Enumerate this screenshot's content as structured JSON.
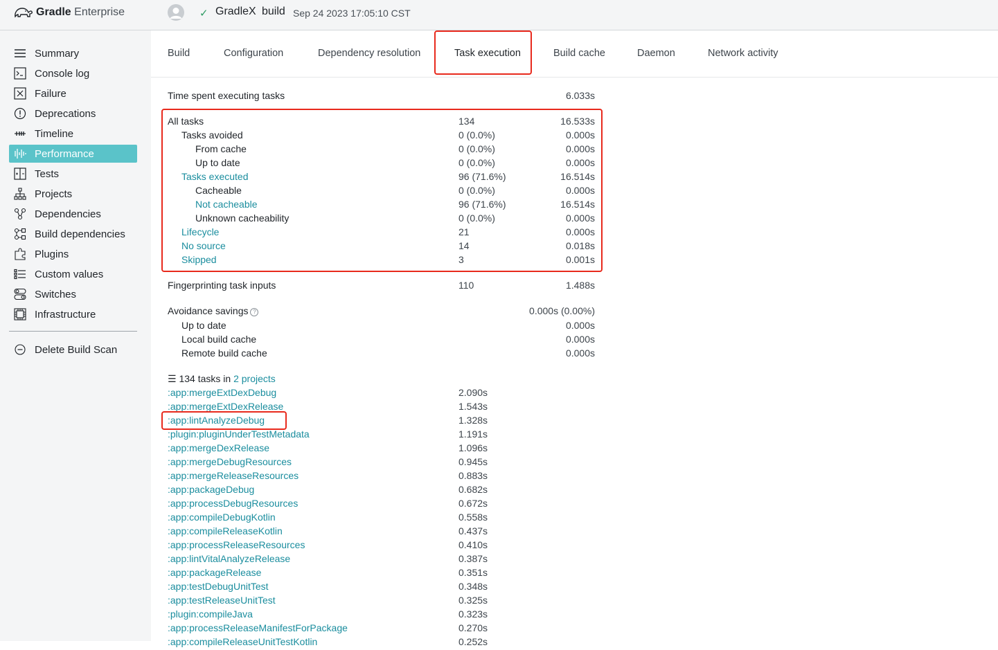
{
  "header": {
    "logo_bold": "Gradle",
    "logo_light": "Enterprise",
    "project": "GradleX",
    "task": "build",
    "date": "Sep 24 2023 17:05:10 CST"
  },
  "sidebar": {
    "items": [
      {
        "label": "Summary",
        "icon": "list-icon"
      },
      {
        "label": "Console log",
        "icon": "terminal-icon"
      },
      {
        "label": "Failure",
        "icon": "x-box-icon"
      },
      {
        "label": "Deprecations",
        "icon": "alert-circle-icon"
      },
      {
        "label": "Timeline",
        "icon": "timeline-icon"
      },
      {
        "label": "Performance",
        "icon": "waveform-icon"
      },
      {
        "label": "Tests",
        "icon": "tests-icon"
      },
      {
        "label": "Projects",
        "icon": "hierarchy-icon"
      },
      {
        "label": "Dependencies",
        "icon": "dependencies-icon"
      },
      {
        "label": "Build dependencies",
        "icon": "build-dependencies-icon"
      },
      {
        "label": "Plugins",
        "icon": "plugin-icon"
      },
      {
        "label": "Custom values",
        "icon": "custom-values-icon"
      },
      {
        "label": "Switches",
        "icon": "switches-icon"
      },
      {
        "label": "Infrastructure",
        "icon": "infrastructure-icon"
      }
    ],
    "active": "Performance",
    "delete_label": "Delete Build Scan"
  },
  "tabs": [
    "Build",
    "Configuration",
    "Dependency resolution",
    "Task execution",
    "Build cache",
    "Daemon",
    "Network activity"
  ],
  "active_tab": "Task execution",
  "summary": {
    "time_spent": {
      "label": "Time spent executing tasks",
      "time": "6.033s"
    },
    "all_tasks": [
      {
        "label": "All tasks",
        "indent": 0,
        "link": false,
        "count": "134",
        "time": "16.533s"
      },
      {
        "label": "Tasks avoided",
        "indent": 1,
        "link": false,
        "count": "0 (0.0%)",
        "time": "0.000s"
      },
      {
        "label": "From cache",
        "indent": 2,
        "link": false,
        "count": "0 (0.0%)",
        "time": "0.000s"
      },
      {
        "label": "Up to date",
        "indent": 2,
        "link": false,
        "count": "0 (0.0%)",
        "time": "0.000s"
      },
      {
        "label": "Tasks executed",
        "indent": 1,
        "link": true,
        "count": "96 (71.6%)",
        "time": "16.514s"
      },
      {
        "label": "Cacheable",
        "indent": 2,
        "link": false,
        "count": "0 (0.0%)",
        "time": "0.000s"
      },
      {
        "label": "Not cacheable",
        "indent": 2,
        "link": true,
        "count": "96 (71.6%)",
        "time": "16.514s"
      },
      {
        "label": "Unknown cacheability",
        "indent": 2,
        "link": false,
        "count": "0 (0.0%)",
        "time": "0.000s"
      },
      {
        "label": "Lifecycle",
        "indent": 1,
        "link": true,
        "count": "21",
        "time": "0.000s"
      },
      {
        "label": "No source",
        "indent": 1,
        "link": true,
        "count": "14",
        "time": "0.018s"
      },
      {
        "label": "Skipped",
        "indent": 1,
        "link": true,
        "count": "3",
        "time": "0.001s"
      }
    ],
    "fingerprinting": {
      "label": "Fingerprinting task inputs",
      "count": "110",
      "time": "1.488s"
    },
    "avoidance": {
      "label": "Avoidance savings",
      "help": "?",
      "time": "0.000s (0.00%)",
      "rows": [
        {
          "label": "Up to date",
          "time": "0.000s"
        },
        {
          "label": "Local build cache",
          "time": "0.000s"
        },
        {
          "label": "Remote build cache",
          "time": "0.000s"
        }
      ]
    }
  },
  "tasks_header": {
    "count": "134 tasks",
    "in": "in",
    "projects": "2 projects"
  },
  "tasks": [
    {
      "name": ":app:mergeExtDexDebug",
      "duration": "2.090s"
    },
    {
      "name": ":app:mergeExtDexRelease",
      "duration": "1.543s"
    },
    {
      "name": ":app:lintAnalyzeDebug",
      "duration": "1.328s"
    },
    {
      "name": ":plugin:pluginUnderTestMetadata",
      "duration": "1.191s"
    },
    {
      "name": ":app:mergeDexRelease",
      "duration": "1.096s"
    },
    {
      "name": ":app:mergeDebugResources",
      "duration": "0.945s"
    },
    {
      "name": ":app:mergeReleaseResources",
      "duration": "0.883s"
    },
    {
      "name": ":app:packageDebug",
      "duration": "0.682s"
    },
    {
      "name": ":app:processDebugResources",
      "duration": "0.672s"
    },
    {
      "name": ":app:compileDebugKotlin",
      "duration": "0.558s"
    },
    {
      "name": ":app:compileReleaseKotlin",
      "duration": "0.437s"
    },
    {
      "name": ":app:processReleaseResources",
      "duration": "0.410s"
    },
    {
      "name": ":app:lintVitalAnalyzeRelease",
      "duration": "0.387s"
    },
    {
      "name": ":app:packageRelease",
      "duration": "0.351s"
    },
    {
      "name": ":app:testDebugUnitTest",
      "duration": "0.348s"
    },
    {
      "name": ":app:testReleaseUnitTest",
      "duration": "0.325s"
    },
    {
      "name": ":plugin:compileJava",
      "duration": "0.323s"
    },
    {
      "name": ":app:processReleaseManifestForPackage",
      "duration": "0.270s"
    },
    {
      "name": ":app:compileReleaseUnitTestKotlin",
      "duration": "0.252s"
    }
  ],
  "colors": {
    "accent": "#5ac3c9",
    "link": "#1a8d9e",
    "highlight": "#e8291c",
    "success": "#2e9b63"
  }
}
